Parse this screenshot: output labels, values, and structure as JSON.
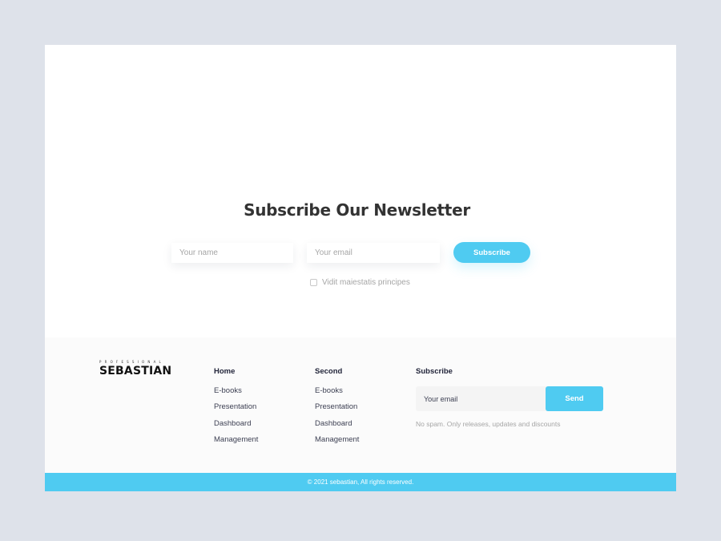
{
  "newsletter": {
    "title": "Subscribe Our Newsletter",
    "name_placeholder": "Your name",
    "email_placeholder": "Your email",
    "subscribe_label": "Subscribe",
    "checkbox_label": "Vidit maiestatis principes",
    "checkbox_checked": false
  },
  "footer": {
    "logo": {
      "tagline": "PROFESSIONAL",
      "name": "SEBASTIAN"
    },
    "columns": [
      {
        "heading": "Home",
        "links": [
          "E-books",
          "Presentation",
          "Dashboard",
          "Management"
        ]
      },
      {
        "heading": "Second",
        "links": [
          "E-books",
          "Presentation",
          "Dashboard",
          "Management"
        ]
      }
    ],
    "subscribe": {
      "heading": "Subscribe",
      "email_placeholder": "Your email",
      "send_label": "Send",
      "note": "No spam. Only releases, updates and discounts"
    },
    "copyright": "© 2021 sebastian, All rights reserved."
  },
  "colors": {
    "accent": "#4fcbf1",
    "page_bg": "#dee2ea",
    "footer_bg": "#fbfbfb",
    "heading": "#333333"
  }
}
